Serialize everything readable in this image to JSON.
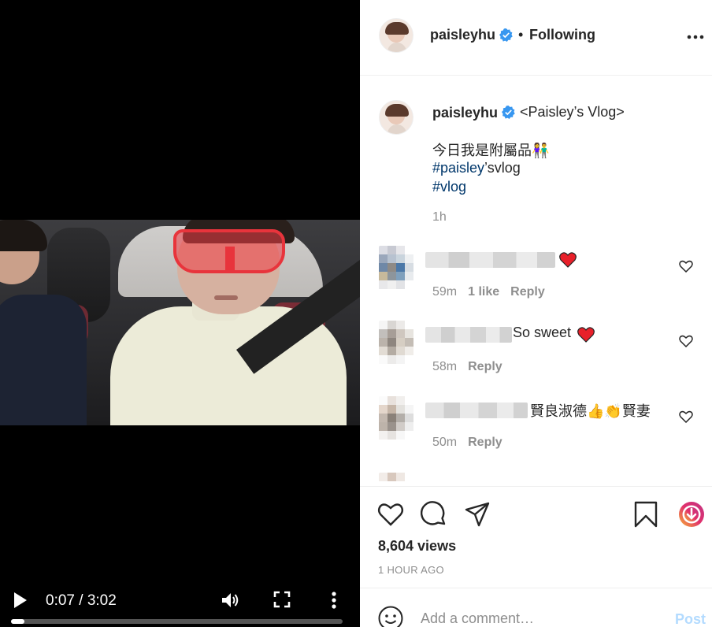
{
  "video": {
    "current_time": "0:07",
    "duration": "3:02",
    "time_separator": " / ",
    "progress_fraction": 0.04
  },
  "header": {
    "username": "paisleyhu",
    "separator": "•",
    "follow_status": "Following"
  },
  "caption": {
    "username": "paisleyhu",
    "title": "<Paisley’s Vlog>",
    "line1": "今日我是附屬品👫",
    "hashtag1_tag": "#paisley",
    "hashtag1_rest": "’svlog",
    "hashtag2": "#vlog",
    "time": "1h"
  },
  "comments": [
    {
      "text": "",
      "time": "59m",
      "likes": "1 like",
      "reply": "Reply"
    },
    {
      "text": "So sweet",
      "time": "58m",
      "reply": "Reply"
    },
    {
      "text": "賢良淑德👍👏賢妻",
      "time": "50m",
      "reply": "Reply"
    }
  ],
  "stats": {
    "views": "8,604 views",
    "time_ago": "1 HOUR AGO"
  },
  "composer": {
    "placeholder": "Add a comment…",
    "post_label": "Post"
  },
  "colors": {
    "verified": "#3897f0",
    "heart": "#ed4956",
    "hashtag": "#00376b",
    "post_disabled": "#b3dbff"
  }
}
